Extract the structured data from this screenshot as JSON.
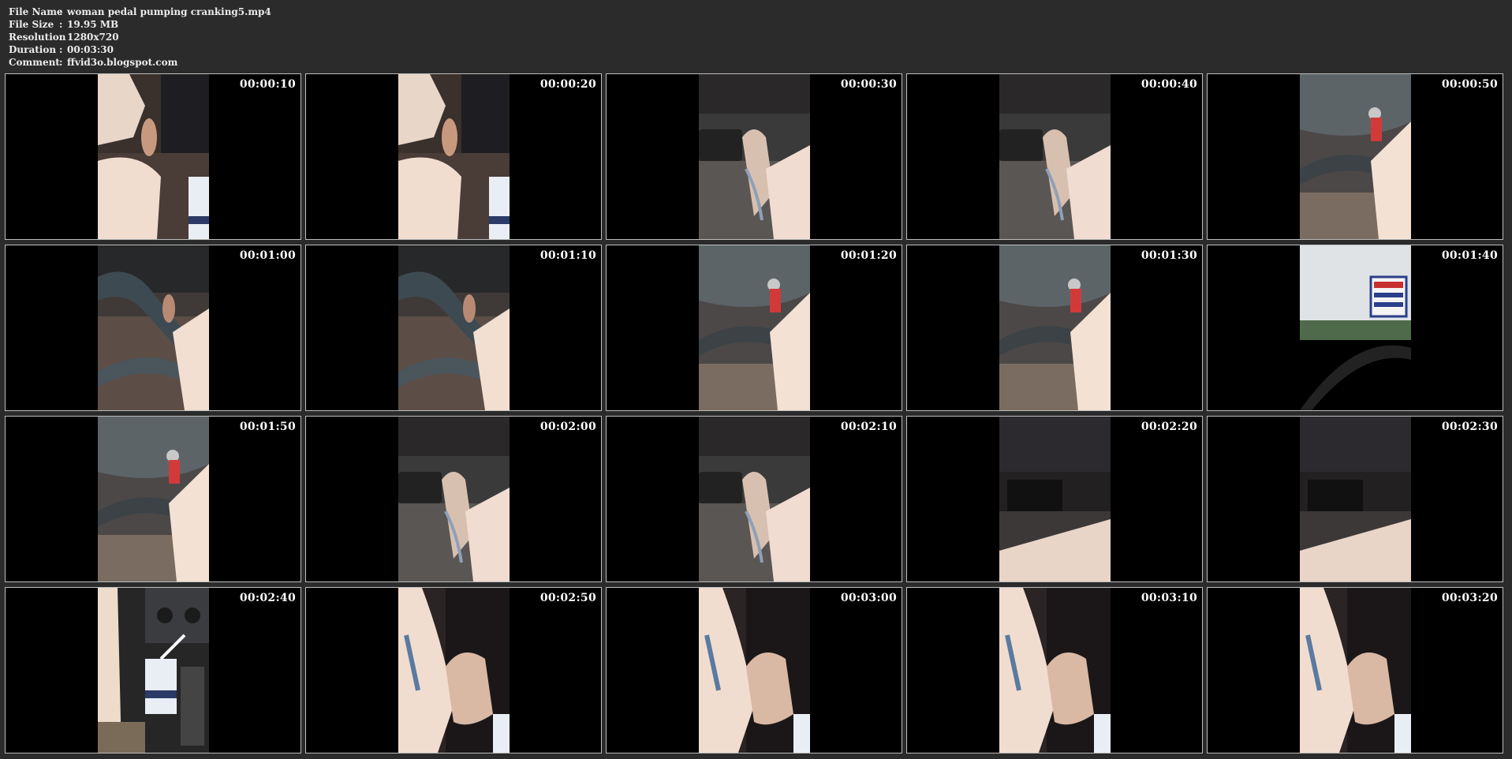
{
  "file_info": {
    "name_label": "File Name",
    "name_value": "woman pedal pumping cranking5.mp4",
    "size_label": "File Size",
    "size_value": "19.95 MB",
    "resolution_label": "Resolution",
    "resolution_value": "1280x720",
    "duration_label": "Duration",
    "duration_value": "00:03:30",
    "comment_label": "Comment",
    "comment_value": "ffvid3o.blogspot.com",
    "separator": ":"
  },
  "thumbnails": [
    {
      "time": "00:00:10",
      "scene": "pedal-leg"
    },
    {
      "time": "00:00:20",
      "scene": "pedal-leg"
    },
    {
      "time": "00:00:30",
      "scene": "floor-foot"
    },
    {
      "time": "00:00:40",
      "scene": "floor-foot"
    },
    {
      "time": "00:00:50",
      "scene": "wheel-keys"
    },
    {
      "time": "00:01:00",
      "scene": "wheel-pedal"
    },
    {
      "time": "00:01:10",
      "scene": "wheel-pedal"
    },
    {
      "time": "00:01:20",
      "scene": "wheel-keys"
    },
    {
      "time": "00:01:30",
      "scene": "wheel-keys"
    },
    {
      "time": "00:01:40",
      "scene": "window-sign"
    },
    {
      "time": "00:01:50",
      "scene": "wheel-keys"
    },
    {
      "time": "00:02:00",
      "scene": "floor-foot"
    },
    {
      "time": "00:02:10",
      "scene": "floor-foot"
    },
    {
      "time": "00:02:20",
      "scene": "dark-floor"
    },
    {
      "time": "00:02:30",
      "scene": "dark-floor"
    },
    {
      "time": "00:02:40",
      "scene": "console-cup"
    },
    {
      "time": "00:02:50",
      "scene": "leg-foot"
    },
    {
      "time": "00:03:00",
      "scene": "leg-foot"
    },
    {
      "time": "00:03:10",
      "scene": "leg-foot"
    },
    {
      "time": "00:03:20",
      "scene": "leg-foot"
    }
  ]
}
